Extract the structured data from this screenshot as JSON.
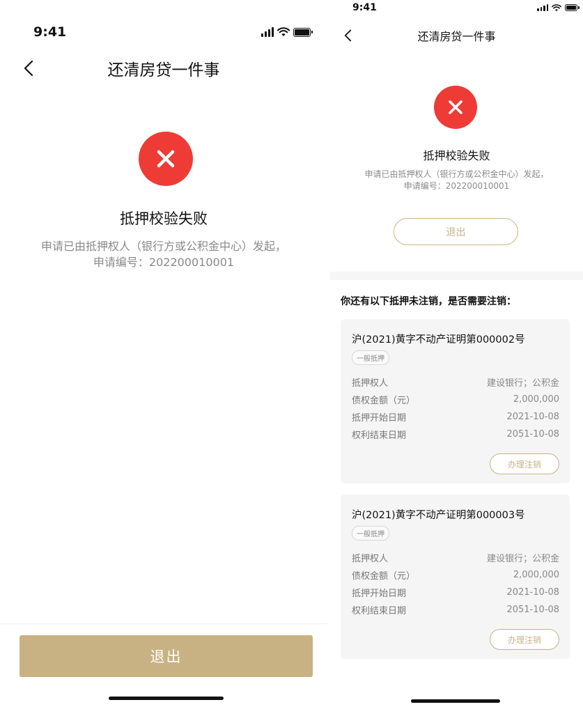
{
  "left": {
    "status": {
      "time": "9:41"
    },
    "nav": {
      "title": "还清房贷一件事"
    },
    "result": {
      "title": "抵押校验失败",
      "desc_line1": "申请已由抵押权人（银行方或公积金中心）发起，",
      "desc_line2": "申请编号：202200010001"
    },
    "exit_label": "退出"
  },
  "right": {
    "status": {
      "time": "9:41"
    },
    "nav": {
      "title": "还清房贷一件事"
    },
    "result": {
      "title": "抵押校验失败",
      "desc_line1": "申请已由抵押权人（银行方或公积金中心）发起，",
      "desc_line2": "申请编号：202200010001"
    },
    "exit_label": "退出",
    "section_title": "你还有以下抵押未注销，是否需要注销：",
    "certificates": [
      {
        "title": "沪(2021)黄字不动产证明第000002号",
        "tag": "一般抵押",
        "fields": [
          {
            "label": "抵押权人",
            "value": "建设银行；公积金"
          },
          {
            "label": "债权金额（元）",
            "value": "2,000,000"
          },
          {
            "label": "抵押开始日期",
            "value": "2021-10-08"
          },
          {
            "label": "权利结束日期",
            "value": "2051-10-08"
          }
        ],
        "action": "办理注销"
      },
      {
        "title": "沪(2021)黄字不动产证明第000003号",
        "tag": "一般抵押",
        "fields": [
          {
            "label": "抵押权人",
            "value": "建设银行；公积金"
          },
          {
            "label": "债权金额（元）",
            "value": "2,000,000"
          },
          {
            "label": "抵押开始日期",
            "value": "2021-10-08"
          },
          {
            "label": "权利结束日期",
            "value": "2051-10-08"
          }
        ],
        "action": "办理注销"
      }
    ]
  },
  "icons": {
    "back": "chevron-left-icon",
    "fail": "close-icon",
    "signal": "cellular-signal-icon",
    "wifi": "wifi-icon",
    "battery": "battery-icon"
  },
  "colors": {
    "accent": "#c8b283",
    "error": "#ef3b36",
    "card_bg": "#f5f5f6"
  }
}
